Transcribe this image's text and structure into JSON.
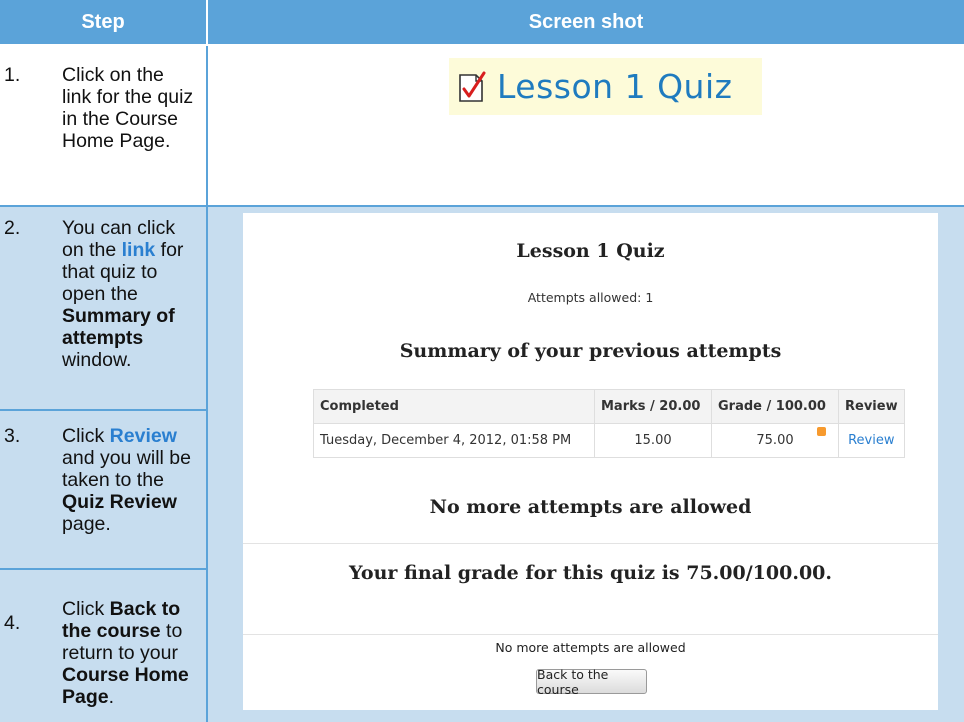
{
  "header": {
    "step": "Step",
    "screenshot": "Screen shot"
  },
  "steps": [
    {
      "num": "1.",
      "parts": [
        "Click on the link for the quiz in the Course Home Page."
      ]
    },
    {
      "num": "2.",
      "parts": [
        "You can click on the ",
        "link",
        " for that quiz to open the ",
        "Summary of attempts",
        " window."
      ]
    },
    {
      "num": "3.",
      "parts": [
        "Click ",
        "Review",
        " and you will be taken to the ",
        "Quiz Review",
        " page."
      ]
    },
    {
      "num": "4.",
      "parts": [
        "Click ",
        "Back to the course",
        " to return to your ",
        "Course Home Page",
        "."
      ]
    }
  ],
  "lesson_link": {
    "label": "Lesson 1 Quiz",
    "icon": "quiz-checkmark-icon"
  },
  "quiz_panel": {
    "title": "Lesson 1 Quiz",
    "attempts_allowed": "Attempts allowed: 1",
    "summary_heading": "Summary of your previous attempts",
    "table": {
      "headers": [
        "Completed",
        "Marks / 20.00",
        "Grade / 100.00",
        "Review"
      ],
      "row": [
        "Tuesday, December 4, 2012, 01:58 PM",
        "15.00",
        "75.00",
        "Review"
      ]
    },
    "no_more_heading": "No more attempts are allowed",
    "final_grade": "Your final grade for this quiz is 75.00/100.00.",
    "no_more_small": "No more attempts are allowed",
    "back_button": "Back to the course"
  },
  "colors": {
    "header_blue": "#5ba3d9",
    "light_blue": "#c7ddef",
    "link_blue": "#2a7fd0",
    "badge_orange": "#f79a2e"
  }
}
